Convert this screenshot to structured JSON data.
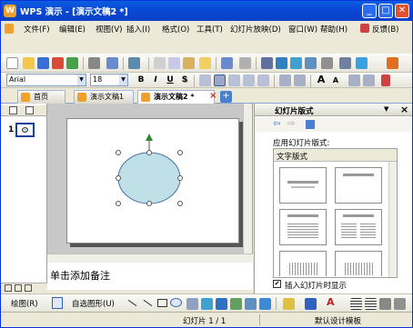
{
  "window": {
    "title": "WPS 演示 - [演示文稿2 *]",
    "app_icon_label": "W",
    "min": "_",
    "max": "□",
    "close": "✕"
  },
  "menubar": {
    "items": [
      "文件(F)",
      "编辑(E)",
      "视图(V)",
      "插入(I)",
      "格式(O)",
      "工具(T)",
      "幻灯片放映(D)",
      "窗口(W)",
      "帮助(H)"
    ],
    "feedback": "反馈(B)"
  },
  "formatting": {
    "font_name": "Arial",
    "font_size": "18",
    "bold": "B",
    "italic": "I",
    "underline": "U",
    "shadow": "S",
    "grow": "A",
    "shrink": "A"
  },
  "tabs": [
    {
      "label": "首页"
    },
    {
      "label": "演示文稿1"
    },
    {
      "label": "演示文稿2 *"
    }
  ],
  "tab_close": "×",
  "tab_add": "+",
  "slides_pane": {
    "slide_number": "1"
  },
  "notes": {
    "placeholder": "单击添加备注"
  },
  "taskpane": {
    "title": "幻灯片版式",
    "section_label": "应用幻灯片版式:",
    "group_label": "文字版式",
    "show_on_insert": "插入幻灯片时显示",
    "close": "×"
  },
  "drawing": {
    "draw_label": "绘图(R)",
    "autoshape_label": "自选图形(U)"
  },
  "statusbar": {
    "slide_info": "幻灯片 1 / 1",
    "template": "默认设计模板"
  },
  "colors": {
    "ellipse_fill": "#bfe0e6",
    "ellipse_stroke": "#4a6fa5",
    "titlebar": "#0a49d6"
  }
}
